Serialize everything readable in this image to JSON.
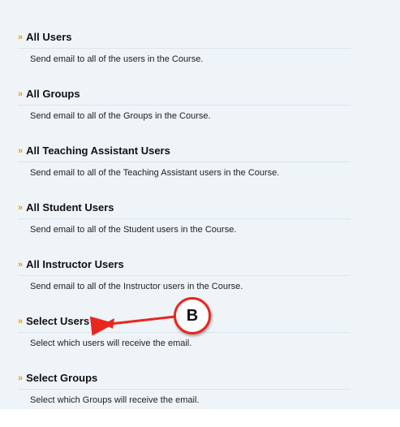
{
  "options": [
    {
      "title": "All Users",
      "description": "Send email to all of the users in the Course."
    },
    {
      "title": "All Groups",
      "description": "Send email to all of the Groups in the Course."
    },
    {
      "title": "All Teaching Assistant Users",
      "description": "Send email to all of the Teaching Assistant users in the Course."
    },
    {
      "title": "All Student Users",
      "description": "Send email to all of the Student users in the Course."
    },
    {
      "title": "All Instructor Users",
      "description": "Send email to all of the Instructor users in the Course."
    },
    {
      "title": "Select Users",
      "description": "Select which users will receive the email."
    },
    {
      "title": "Select Groups",
      "description": "Select which Groups will receive the email."
    }
  ],
  "bullet_glyph": "»",
  "callout": {
    "label": "B",
    "color": "#e8271f"
  },
  "colors": {
    "bullet": "#e0a21a",
    "panel": "#eef4f8"
  }
}
